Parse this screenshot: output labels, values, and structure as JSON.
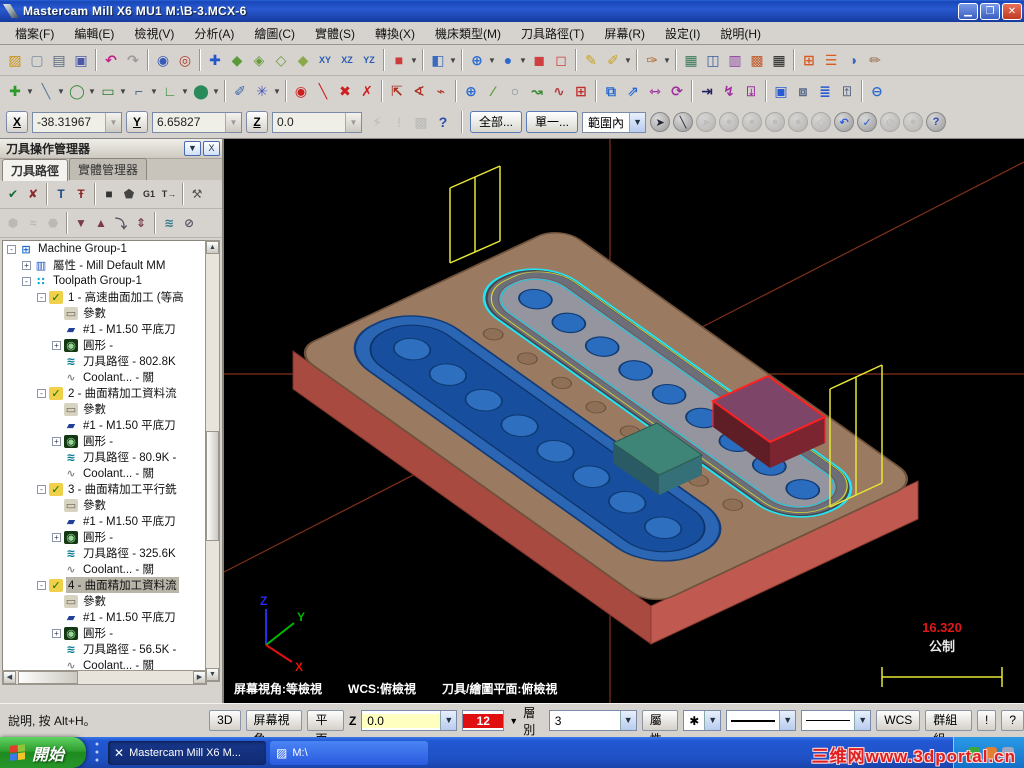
{
  "window": {
    "title": "Mastercam Mill X6 MU1  M:\\B-3.MCX-6"
  },
  "menu": {
    "items": [
      "檔案(F)",
      "編輯(E)",
      "檢視(V)",
      "分析(A)",
      "繪圖(C)",
      "實體(S)",
      "轉換(X)",
      "機床類型(M)",
      "刀具路徑(T)",
      "屏幕(R)",
      "設定(I)",
      "說明(H)"
    ]
  },
  "toolbar1": {
    "icons": [
      {
        "n": "open-file",
        "g": "▨",
        "c": "#c89018"
      },
      {
        "n": "new-file",
        "g": "▢",
        "c": "#7a8aa0"
      },
      {
        "n": "print",
        "g": "▤",
        "c": "#5a6a80"
      },
      {
        "n": "save",
        "g": "▣",
        "c": "#4a5aa8"
      },
      {
        "sep": true
      },
      {
        "n": "undo",
        "g": "↶",
        "c": "#c0208a"
      },
      {
        "n": "redo",
        "g": "↷",
        "c": "#9a9a9a"
      },
      {
        "sep": true
      },
      {
        "n": "zoom-window",
        "g": "◉",
        "c": "#3a5ab8"
      },
      {
        "n": "zoom-out",
        "g": "◎",
        "c": "#b03828"
      },
      {
        "sep": true
      },
      {
        "n": "pan",
        "g": "✚",
        "c": "#2255cc"
      },
      {
        "n": "dynamic-rotate",
        "g": "◆",
        "c": "#5a9a3a"
      },
      {
        "n": "iso-view",
        "g": "◈",
        "c": "#6a9a3a"
      },
      {
        "n": "front-view",
        "g": "◇",
        "c": "#6a9a3a"
      },
      {
        "n": "side-view",
        "g": "◆",
        "c": "#8aaa4a"
      },
      {
        "n": "rotate-xy",
        "g": "XY",
        "c": "#2a5ab0"
      },
      {
        "n": "rotate-xz",
        "g": "XZ",
        "c": "#2a5ab0"
      },
      {
        "n": "rotate-yz",
        "g": "YZ",
        "c": "#2a5ab0"
      },
      {
        "sep": true
      },
      {
        "n": "gview-cube",
        "g": "■",
        "c": "#cc3a3a",
        "dd": true
      },
      {
        "sep": true
      },
      {
        "n": "planes-cube",
        "g": "◧",
        "c": "#3a6ac0",
        "dd": true
      },
      {
        "sep": true
      },
      {
        "n": "wcs-globe",
        "g": "⊕",
        "c": "#2a6ad0",
        "dd": true
      },
      {
        "n": "z-depth-sphere",
        "g": "●",
        "c": "#2a6ad0",
        "dd": true
      },
      {
        "n": "solid-shaded",
        "g": "◼",
        "c": "#d04040"
      },
      {
        "n": "solid-wireframe",
        "g": "◻",
        "c": "#d04040"
      },
      {
        "sep": true
      },
      {
        "n": "attributes-pencil",
        "g": "✎",
        "c": "#c8a020"
      },
      {
        "n": "attributes-multi",
        "g": "✐",
        "c": "#c8a020",
        "dd": true
      },
      {
        "sep": true
      },
      {
        "n": "feature-tool",
        "g": "✑",
        "c": "#b06a2a",
        "dd": true
      },
      {
        "sep": true
      },
      {
        "n": "grid-settings",
        "g": "▦",
        "c": "#3a7a5a"
      },
      {
        "n": "copy-screen",
        "g": "◫",
        "c": "#3a5aa0"
      },
      {
        "n": "combine-views",
        "g": "▥",
        "c": "#8a3aa0"
      },
      {
        "n": "tile-windows",
        "g": "▩",
        "c": "#c05a2a"
      },
      {
        "n": "color-cells",
        "g": "▦",
        "c": "#222"
      },
      {
        "sep": true
      },
      {
        "n": "orange-grid",
        "g": "⊞",
        "c": "#d85a20"
      },
      {
        "n": "orange-list",
        "g": "☰",
        "c": "#d85a20"
      },
      {
        "n": "shade-half",
        "g": "◑",
        "c": "#3a6ac0"
      },
      {
        "n": "blank-entity",
        "g": "✏",
        "c": "#9a6a4a"
      }
    ]
  },
  "toolbar2": {
    "icons": [
      {
        "n": "create-point",
        "g": "✚",
        "c": "#2a9a2a",
        "dd": true
      },
      {
        "n": "create-line",
        "g": "╲",
        "c": "#5a7a9a",
        "dd": true
      },
      {
        "n": "create-arc",
        "g": "◯",
        "c": "#3a8a3a",
        "dd": true
      },
      {
        "n": "create-rectangle",
        "g": "▭",
        "c": "#2a7a2a",
        "dd": true
      },
      {
        "n": "create-fillet",
        "g": "⌐",
        "c": "#4a6a8a",
        "dd": true
      },
      {
        "n": "create-polyline",
        "g": "∟",
        "c": "#3a8a3a",
        "dd": true
      },
      {
        "n": "create-cylinder",
        "g": "⬤",
        "c": "#2a8a5a",
        "dd": true
      },
      {
        "sep": true
      },
      {
        "n": "spray-tool",
        "g": "✐",
        "c": "#3a66aa"
      },
      {
        "n": "snap-settings",
        "g": "✳",
        "c": "#4a55b8",
        "dd": true
      },
      {
        "sep": true
      },
      {
        "n": "sketch-origin",
        "g": "◉",
        "c": "#cc2020"
      },
      {
        "n": "sketch-line",
        "g": "╲",
        "c": "#cc2020"
      },
      {
        "n": "sketch-intersect",
        "g": "✖",
        "c": "#cc2020"
      },
      {
        "n": "sketch-trim",
        "g": "✗",
        "c": "#cc2020"
      },
      {
        "sep": true
      },
      {
        "n": "analyze-distance",
        "g": "⇱",
        "c": "#aa3020"
      },
      {
        "n": "analyze-angle",
        "g": "∢",
        "c": "#aa3020"
      },
      {
        "n": "analyze-chain",
        "g": "⌁",
        "c": "#aa3020"
      },
      {
        "sep": true
      },
      {
        "n": "analyze-globe",
        "g": "⊕",
        "c": "#2a6ad0"
      },
      {
        "n": "analyze-point",
        "g": "⁄",
        "c": "#5a9a3a"
      },
      {
        "n": "analyze-circle",
        "g": "○",
        "c": "#7a8a9a"
      },
      {
        "n": "analyze-contour",
        "g": "↝",
        "c": "#3a8a3a"
      },
      {
        "n": "analyze-surface",
        "g": "∿",
        "c": "#b04040"
      },
      {
        "n": "analyze-grid",
        "g": "⊞",
        "c": "#c03030"
      },
      {
        "sep": true
      },
      {
        "n": "xform-translate",
        "g": "⧉",
        "c": "#2a6ad0"
      },
      {
        "n": "xform-copy",
        "g": "⇗",
        "c": "#2a6ad0"
      },
      {
        "n": "xform-mirror",
        "g": "⇿",
        "c": "#a030a0"
      },
      {
        "n": "xform-rotate",
        "g": "⟳",
        "c": "#a030a0"
      },
      {
        "sep": true
      },
      {
        "n": "xform-offset",
        "g": "⇥",
        "c": "#202060"
      },
      {
        "n": "xform-roll",
        "g": "↯",
        "c": "#a030a0"
      },
      {
        "n": "xform-drag",
        "g": "⍗",
        "c": "#a030a0"
      },
      {
        "sep": true
      },
      {
        "n": "stock-spiral",
        "g": "▣",
        "c": "#2a5ad0"
      },
      {
        "n": "stock-bound",
        "g": "⧈",
        "c": "#5a6a8a"
      },
      {
        "n": "stock-layers",
        "g": "≣",
        "c": "#2a5ad0"
      },
      {
        "n": "stock-person",
        "g": "⍐",
        "c": "#5a6a8a"
      },
      {
        "sep": true
      },
      {
        "n": "circle-half",
        "g": "⊖",
        "c": "#2a6ad0"
      }
    ]
  },
  "coordbar": {
    "x_label": "X",
    "x_value": "-38.31967",
    "y_label": "Y",
    "y_value": "6.65827",
    "z_label": "Z",
    "z_value": "0.0",
    "autocursor_icons": [
      {
        "n": "fast-point",
        "g": "⚡",
        "c": "#9a9a9a",
        "dis": true
      },
      {
        "n": "exclaim",
        "g": "!",
        "c": "#c0b0a0",
        "dis": true
      },
      {
        "n": "config-box",
        "g": "▩",
        "c": "#9a9a9a",
        "dis": true
      },
      {
        "n": "help-cursor",
        "g": "?",
        "c": "#2a4ab0"
      }
    ],
    "all_button": "全部...",
    "single_button": "單一...",
    "range_combo": "範圍內",
    "select_icons": [
      {
        "n": "select-hat",
        "g": "➤",
        "c": "#223"
      },
      {
        "n": "line-style",
        "g": "╲",
        "c": "#223",
        "dd": true
      },
      {
        "n": "select-arrow",
        "g": "➤",
        "c": "#aaa",
        "dis": true
      },
      {
        "n": "select-c1",
        "g": "●",
        "c": "#aaa",
        "dis": true
      },
      {
        "n": "select-c2",
        "g": "●",
        "c": "#aaa",
        "dis": true
      },
      {
        "n": "select-c3",
        "g": "●",
        "c": "#aaa",
        "dis": true
      },
      {
        "n": "select-c4",
        "g": "●",
        "c": "#aaa",
        "dis": true
      },
      {
        "n": "select-cube",
        "g": "◇",
        "c": "#aaa",
        "dis": true
      },
      {
        "n": "select-undo",
        "g": "↶",
        "c": "#2a5ad8"
      },
      {
        "n": "select-ok",
        "g": "✓",
        "c": "#2a5ad8"
      },
      {
        "n": "select-none",
        "g": "⊘",
        "c": "#aaa",
        "dis": true
      },
      {
        "n": "select-circle",
        "g": "●",
        "c": "#aaa",
        "dis": true
      },
      {
        "n": "select-help",
        "g": "?",
        "c": "#2a4ab0"
      }
    ]
  },
  "panel": {
    "title": "刀具操作管理器",
    "menu_button": "▼",
    "close_button": "X",
    "tabs": [
      {
        "label": "刀具路徑",
        "active": true
      },
      {
        "label": "實體管理器",
        "active": false
      }
    ],
    "tools_row1": [
      {
        "n": "select-all-ops",
        "g": "✔",
        "c": "#1a6a3a"
      },
      {
        "n": "unselect-all-ops",
        "g": "✘",
        "c": "#8a2a2a"
      },
      {
        "sep": true
      },
      {
        "n": "regen-all",
        "g": "T",
        "c": "#1a4a8a"
      },
      {
        "n": "regen-dirty",
        "g": "Ŧ",
        "c": "#8a2a2a"
      },
      {
        "sep": true
      },
      {
        "n": "backplot",
        "g": "■",
        "c": "#333"
      },
      {
        "n": "verify",
        "g": "⬟",
        "c": "#444"
      },
      {
        "n": "g1-code",
        "g": "G1",
        "c": "#333"
      },
      {
        "n": "post-process",
        "g": "T→",
        "c": "#333"
      },
      {
        "sep": true
      },
      {
        "n": "feed-speed",
        "g": "⚒",
        "c": "#555"
      }
    ],
    "tools_row2": [
      {
        "n": "lock",
        "g": "⬢",
        "c": "#9a9a9a",
        "dis": true
      },
      {
        "n": "toolpath-hide",
        "g": "≈",
        "c": "#9a9a9a",
        "dis": true
      },
      {
        "n": "lock-posted",
        "g": "⬣",
        "c": "#9a9a9a",
        "dis": true
      },
      {
        "sep": true
      },
      {
        "n": "move-down",
        "g": "▼",
        "c": "#7a3a4a"
      },
      {
        "n": "move-up",
        "g": "▲",
        "c": "#7a3a4a"
      },
      {
        "n": "insert-arrow",
        "g": "⤵",
        "c": "#556"
      },
      {
        "n": "scroll-ops",
        "g": "⇕",
        "c": "#7a3a4a"
      },
      {
        "sep": true
      },
      {
        "n": "trim-toolpath",
        "g": "≋",
        "c": "#3a7a8a"
      },
      {
        "n": "options-circle",
        "g": "⊘",
        "c": "#556"
      }
    ],
    "tree_icon_styles": {
      "machine-group-icon": {
        "g": "⊞",
        "c": "#1a6ad0",
        "bg": "none"
      },
      "properties-icon": {
        "g": "▥",
        "c": "#1a50c0",
        "bg": "none"
      },
      "toolpath-group-icon": {
        "g": "∷",
        "c": "#00a8d8",
        "bg": "none"
      },
      "operation-icon": {
        "g": "✓",
        "c": "#0a700a",
        "bg": "#f0d048"
      },
      "folder-icon": {
        "g": "▭",
        "c": "#6a6456",
        "bg": "#d8d2c0"
      },
      "tool-icon": {
        "g": "▰",
        "c": "#20409a",
        "bg": "none"
      },
      "geometry-icon": {
        "g": "◉",
        "c": "#9ad89a",
        "bg": "#143814"
      },
      "toolpath-icon": {
        "g": "≋",
        "c": "#007a90",
        "bg": "none"
      },
      "coolant-icon": {
        "g": "∿",
        "c": "#8a8a8a",
        "bg": "none"
      }
    },
    "tree": [
      {
        "lv": 0,
        "icon": "machine-group-icon",
        "exp": "-",
        "label": "Machine Group-1"
      },
      {
        "lv": 1,
        "icon": "properties-icon",
        "exp": "+",
        "label": "屬性 - Mill Default MM"
      },
      {
        "lv": 1,
        "icon": "toolpath-group-icon",
        "exp": "-",
        "label": "Toolpath Group-1"
      },
      {
        "lv": 2,
        "icon": "operation-icon",
        "exp": "-",
        "label": "1 - 高速曲面加工 (等高"
      },
      {
        "lv": 3,
        "icon": "folder-icon",
        "label": "參數"
      },
      {
        "lv": 3,
        "icon": "tool-icon",
        "label": "#1 - M1.50 平底刀"
      },
      {
        "lv": 3,
        "icon": "geometry-icon",
        "exp": "+",
        "label": "圓形 -"
      },
      {
        "lv": 3,
        "icon": "toolpath-icon",
        "label": "刀具路徑 - 802.8K"
      },
      {
        "lv": 3,
        "icon": "coolant-icon",
        "label": "Coolant... - 關"
      },
      {
        "lv": 2,
        "icon": "operation-icon",
        "exp": "-",
        "label": "2 - 曲面精加工資料流"
      },
      {
        "lv": 3,
        "icon": "folder-icon",
        "label": "參數"
      },
      {
        "lv": 3,
        "icon": "tool-icon",
        "label": "#1 - M1.50 平底刀"
      },
      {
        "lv": 3,
        "icon": "geometry-icon",
        "exp": "+",
        "label": "圓形 -"
      },
      {
        "lv": 3,
        "icon": "toolpath-icon",
        "label": "刀具路徑 - 80.9K -"
      },
      {
        "lv": 3,
        "icon": "coolant-icon",
        "label": "Coolant... - 關"
      },
      {
        "lv": 2,
        "icon": "operation-icon",
        "exp": "-",
        "label": "3 - 曲面精加工平行銑"
      },
      {
        "lv": 3,
        "icon": "folder-icon",
        "label": "參數"
      },
      {
        "lv": 3,
        "icon": "tool-icon",
        "label": "#1 - M1.50 平底刀"
      },
      {
        "lv": 3,
        "icon": "geometry-icon",
        "exp": "+",
        "label": "圓形 -"
      },
      {
        "lv": 3,
        "icon": "toolpath-icon",
        "label": "刀具路徑 - 325.6K"
      },
      {
        "lv": 3,
        "icon": "coolant-icon",
        "label": "Coolant... - 關"
      },
      {
        "lv": 2,
        "icon": "operation-icon",
        "exp": "-",
        "label": "4 - 曲面精加工資料流",
        "sel": true
      },
      {
        "lv": 3,
        "icon": "folder-icon",
        "label": "參數"
      },
      {
        "lv": 3,
        "icon": "tool-icon",
        "label": "#1 - M1.50 平底刀"
      },
      {
        "lv": 3,
        "icon": "geometry-icon",
        "exp": "+",
        "label": "圓形 -"
      },
      {
        "lv": 3,
        "icon": "toolpath-icon",
        "label": "刀具路徑 - 56.5K -"
      },
      {
        "lv": 3,
        "icon": "coolant-icon",
        "label": "Coolant... - 關"
      }
    ]
  },
  "viewport": {
    "gnomon": {
      "x": "X",
      "y": "Y",
      "z": "Z"
    },
    "view_angle": "屏幕視角:等檢視",
    "wcs": "WCS:俯檢視",
    "cplane": "刀具/繪圖平面:俯檢視",
    "scale_value": "16.320",
    "scale_unit": "公制"
  },
  "statusbar": {
    "help_text": "說明, 按 Alt+H。",
    "btn_3d": "3D",
    "btn_view": "屏幕視角",
    "btn_plane": "平面",
    "z_label": "Z",
    "z_value": "0.0",
    "color_value": "12",
    "level_label": "層別",
    "level_value": "3",
    "btn_attr": "屬性",
    "point_style": "✱",
    "btn_wcs": "WCS",
    "btn_groups": "群組組",
    "btn_excl": "!",
    "btn_help": "?"
  },
  "taskbar": {
    "start": "開始",
    "tasks": [
      {
        "icon": "✕",
        "label": "Mastercam Mill X6 M...",
        "active": true
      },
      {
        "icon": "▨",
        "label": "M:\\",
        "active": false
      }
    ],
    "watermark": "三维网www.3dportal.cn"
  }
}
